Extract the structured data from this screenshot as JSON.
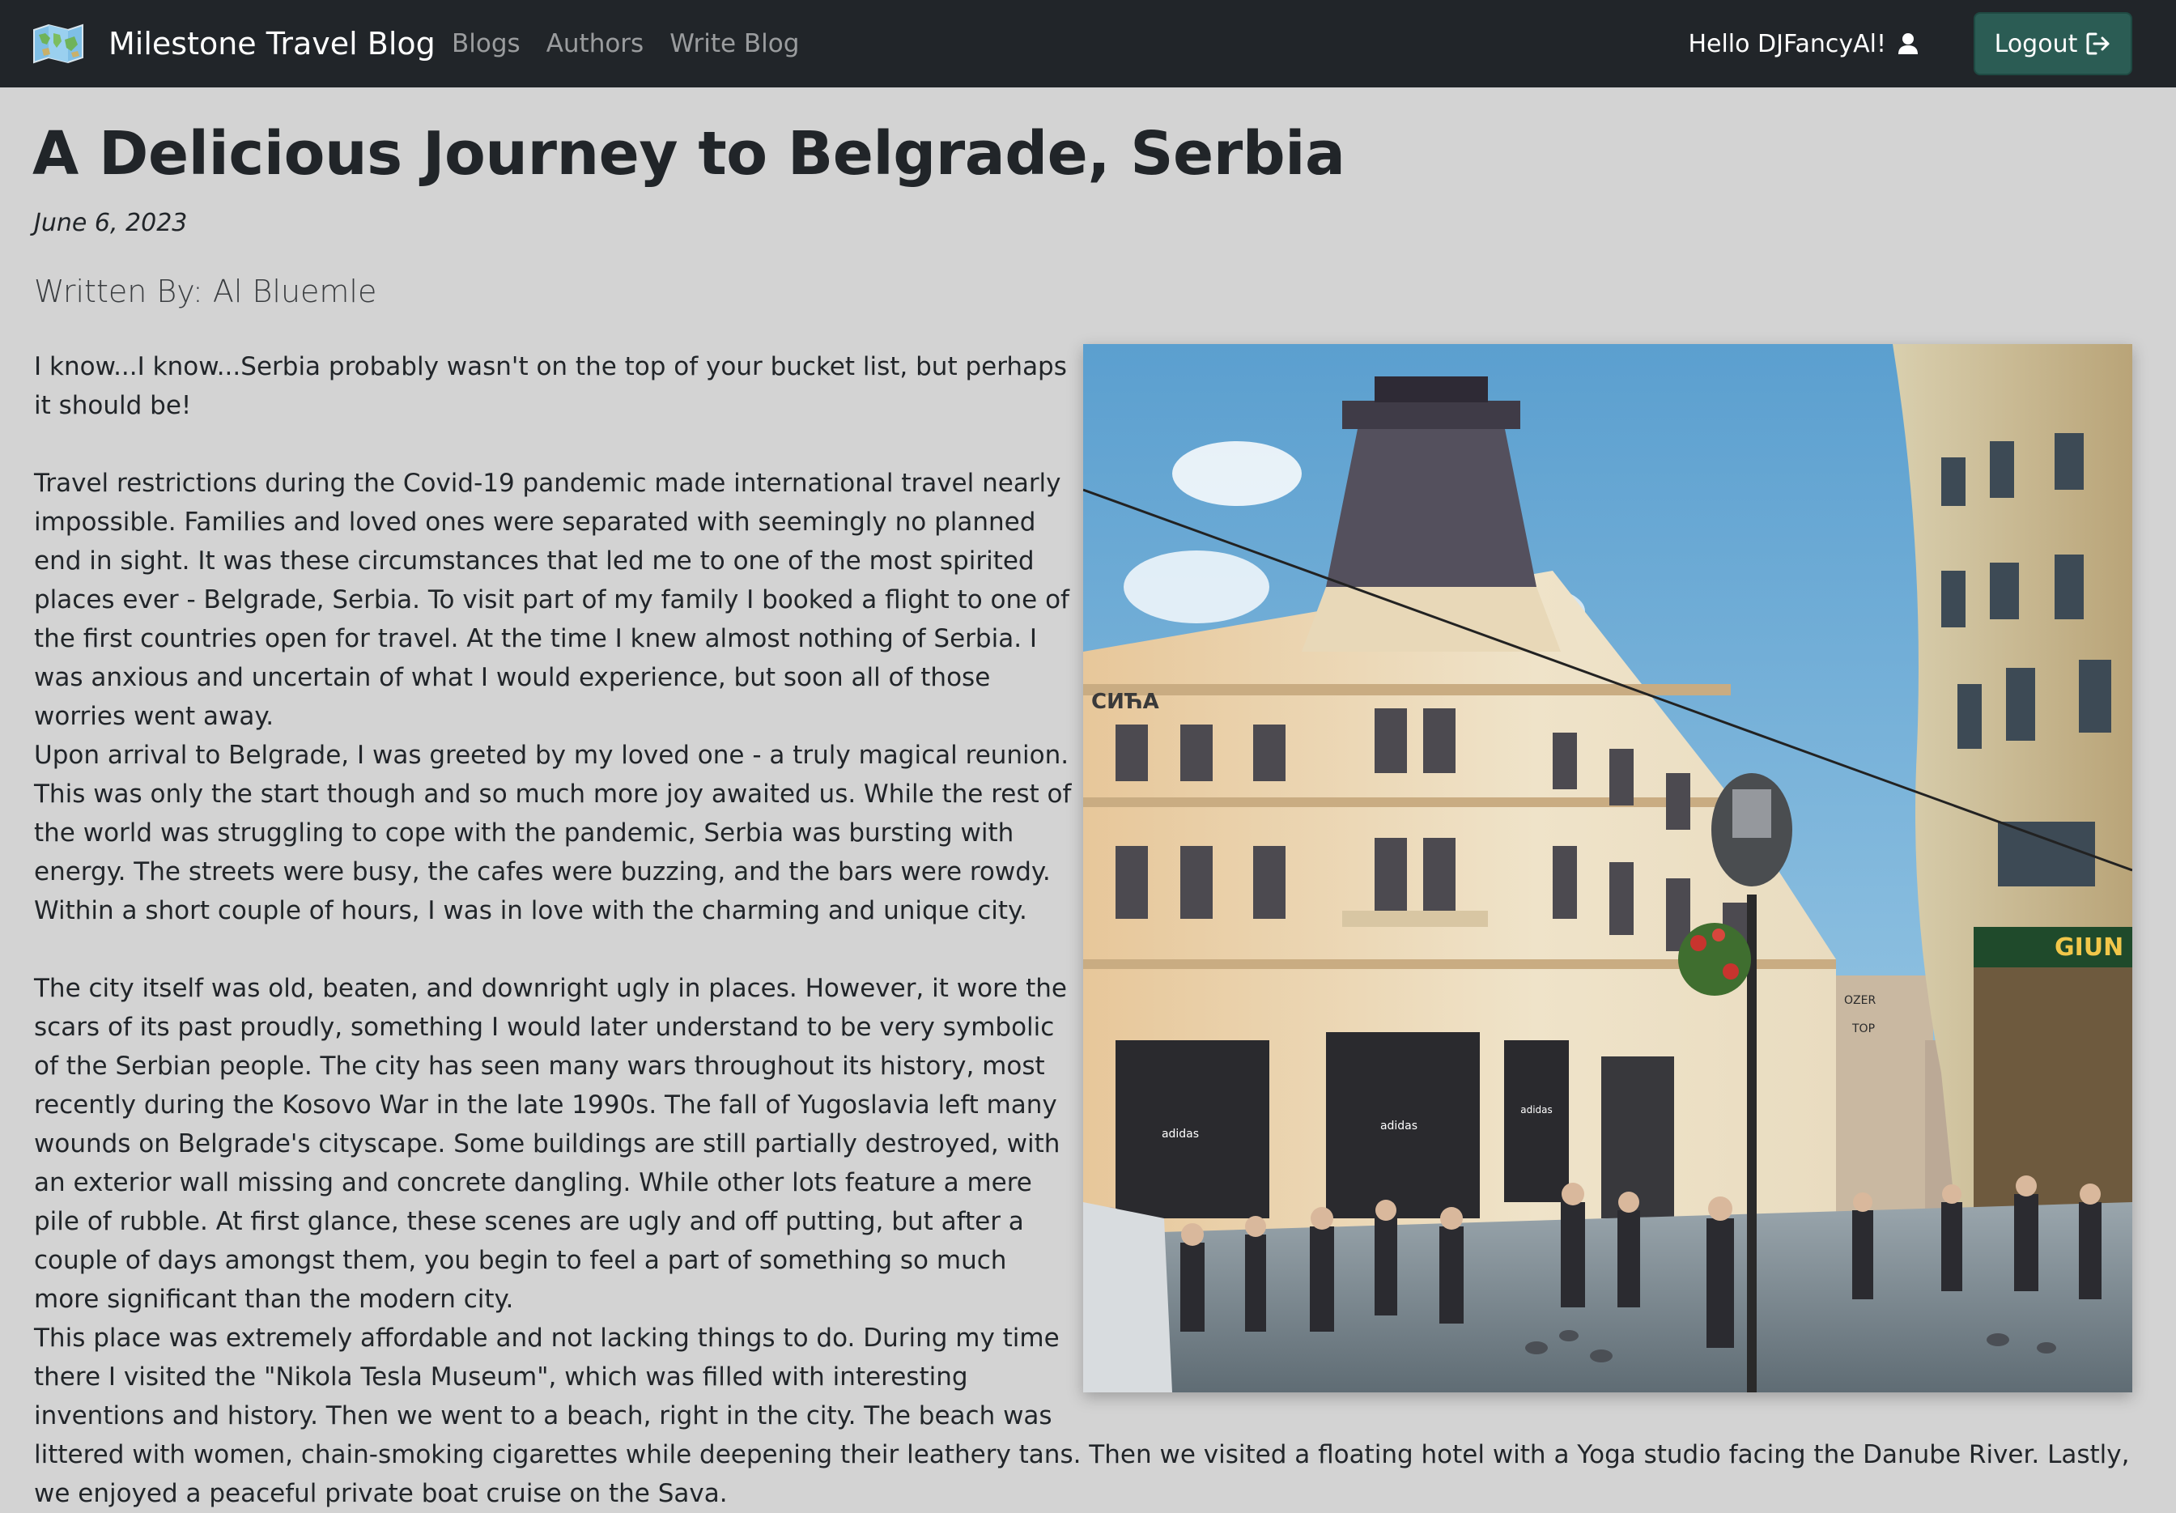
{
  "navbar": {
    "brand": "Milestone Travel Blog",
    "brand_icon": "world-map-icon",
    "links": [
      "Blogs",
      "Authors",
      "Write Blog"
    ],
    "greeting": "Hello DJFancyAl!",
    "user_icon": "user-icon",
    "logout_label": "Logout",
    "logout_icon": "sign-out-icon"
  },
  "article": {
    "title": "A Delicious Journey to Belgrade, Serbia",
    "date": "June 6, 2023",
    "author": "Written By: Al Bluemle",
    "image_signs": {
      "shop_left": "СИЋА",
      "shop_right": "GIUN",
      "store1": "adidas",
      "store2": "adidas",
      "store3": "adidas",
      "sign_small": "OZER",
      "sign_small2": "TOP"
    },
    "paragraphs": [
      "I know...I know...Serbia probably wasn't on the top of your bucket list, but perhaps it should be!",
      "Travel restrictions during the Covid-19 pandemic made international travel nearly impossible. Families and loved ones were separated with seemingly no planned end in sight. It was these circumstances that led me to one of the most spirited places ever - Belgrade, Serbia. To visit part of my family I booked a flight to one of the first countries open for travel. At the time I knew almost nothing of Serbia. I was anxious and uncertain of what I would experience, but soon all of those worries went away.",
      "Upon arrival to Belgrade, I was greeted by my loved one - a truly magical reunion. This was only the start though and so much more joy awaited us. While the rest of the world was struggling to cope with the pandemic, Serbia was bursting with energy. The streets were busy, the cafes were buzzing, and the bars were rowdy. Within a short couple of hours, I was in love with the charming and unique city.",
      "The city itself was old, beaten, and downright ugly in places. However, it wore the scars of its past proudly, something I would later understand to be very symbolic of the Serbian people. The city has seen many wars throughout its history, most recently during the Kosovo War in the late 1990s. The fall of Yugoslavia left many wounds on Belgrade's cityscape. Some buildings are still partially destroyed, with an exterior wall missing and concrete dangling. While other lots feature a mere pile of rubble. At first glance, these scenes are ugly and off putting, but after a couple of days amongst them, you begin to feel a part of something so much more significant than the modern city.",
      "This place was extremely affordable and not lacking things to do. During my time there I visited the \"Nikola Tesla Museum\", which was filled with interesting inventions and history. Then we went to a beach, right in the city. The beach was littered with women, chain-smoking cigarettes while deepening their leathery tans. Then we visited a floating hotel with a Yoga studio facing the Danube River. Lastly, we enjoyed a peaceful private boat cruise on the Sava."
    ]
  }
}
